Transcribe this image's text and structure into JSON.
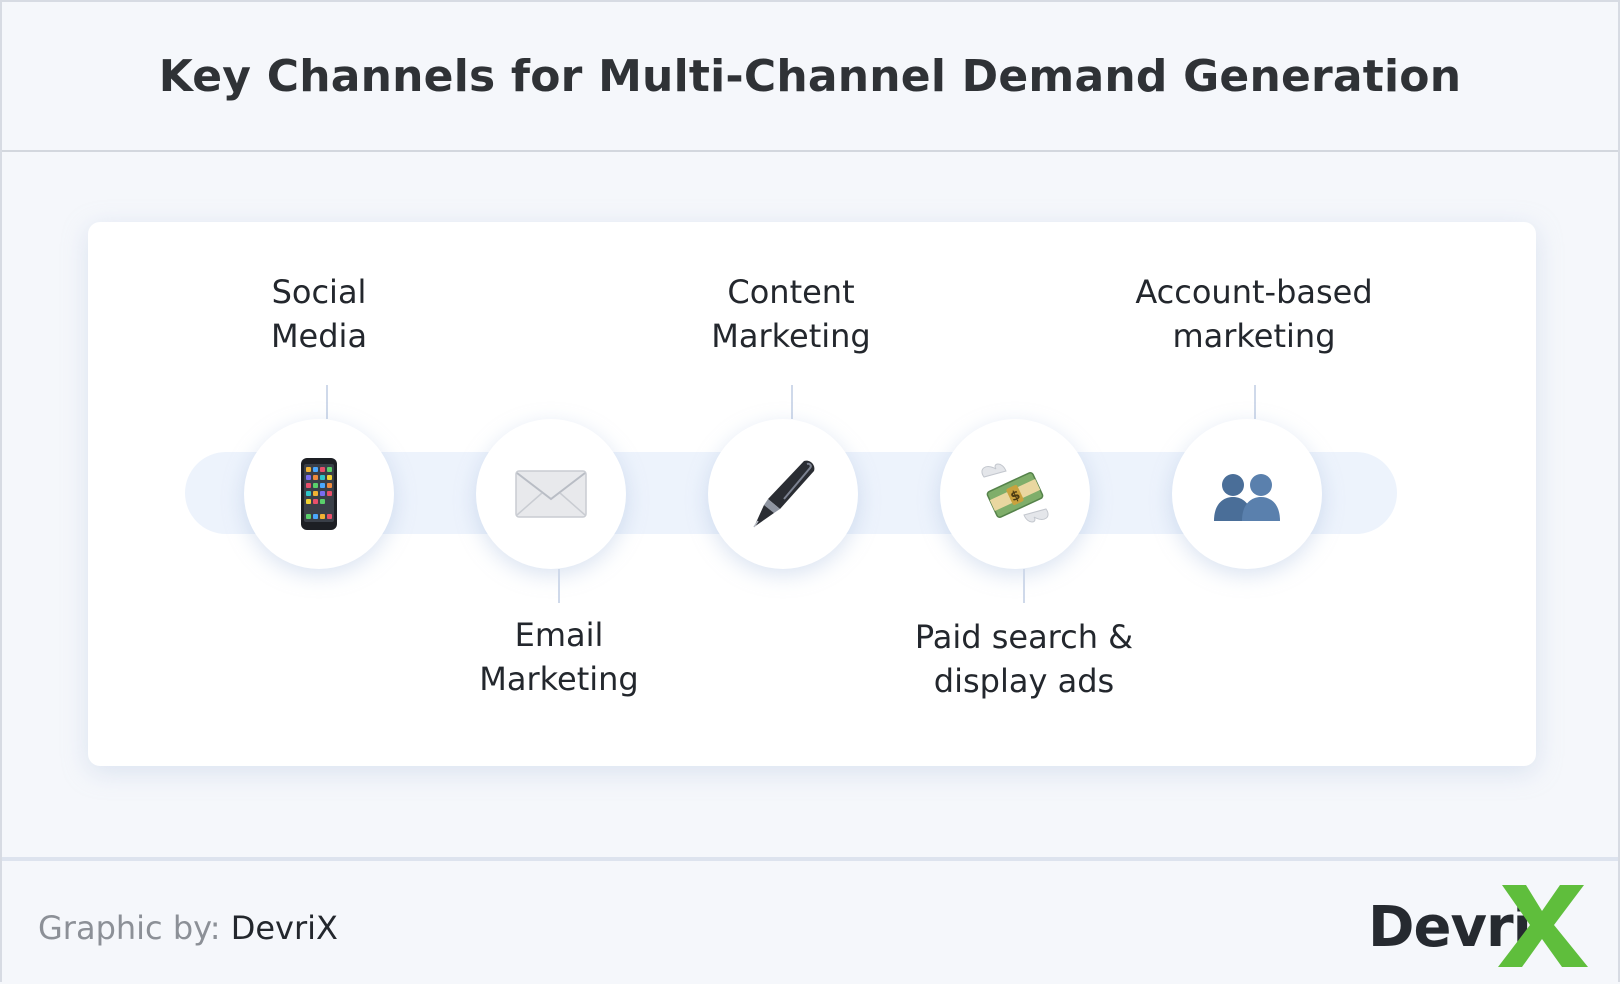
{
  "title": "Key Channels for Multi-Channel Demand Generation",
  "channels": [
    {
      "label_line1": "Social",
      "label_line2": "Media",
      "icon": "mobile-phone-icon",
      "position": "top"
    },
    {
      "label_line1": "Email",
      "label_line2": "Marketing",
      "icon": "envelope-icon",
      "position": "bottom"
    },
    {
      "label_line1": "Content",
      "label_line2": "Marketing",
      "icon": "pen-icon",
      "position": "top"
    },
    {
      "label_line1": "Paid search &",
      "label_line2": "display ads",
      "icon": "money-with-wings-icon",
      "position": "bottom"
    },
    {
      "label_line1": "Account-based",
      "label_line2": "marketing",
      "icon": "people-icon",
      "position": "top"
    }
  ],
  "footer": {
    "credit_prefix": "Graphic by:",
    "credit_brand": "DevriX",
    "logo_text": "Devri",
    "logo_accent_color": "#5fbe3c"
  },
  "colors": {
    "title": "#2f3236",
    "track": "#edf3fc",
    "stem": "#cfd9ea",
    "card": "#ffffff",
    "background": "#f5f7fb"
  }
}
